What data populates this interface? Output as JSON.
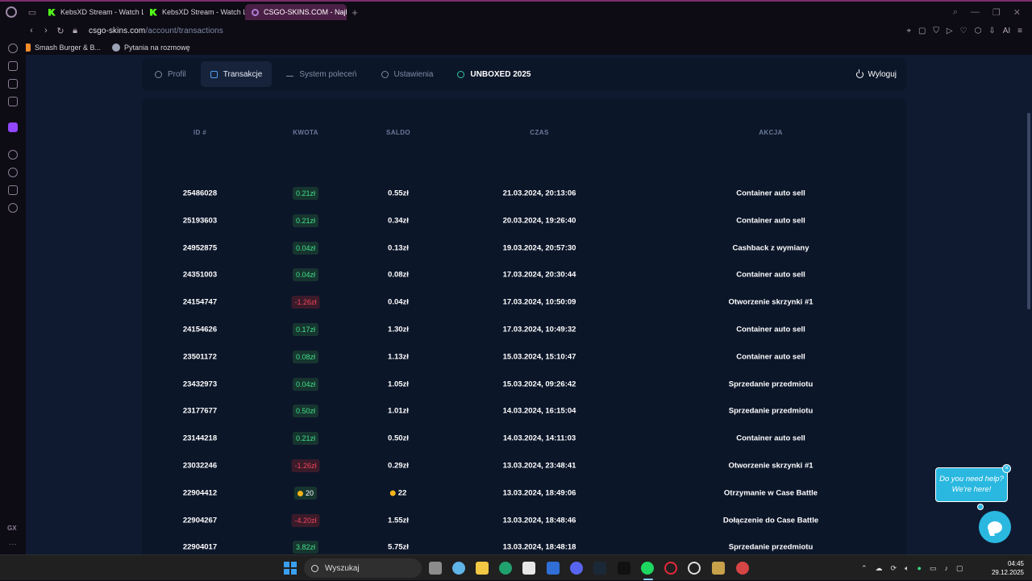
{
  "browser": {
    "tabs": [
      {
        "label": "KebsXD Stream - Watch Li",
        "icon": "kick-icon",
        "active": false
      },
      {
        "label": "KebsXD Stream - Watch Li",
        "icon": "kick-icon",
        "active": false
      },
      {
        "label": "CSGO-SKINS.COM - Najle",
        "icon": "opera-icon",
        "active": true
      }
    ],
    "url_host": "csgo-skins.com",
    "url_path": "/account/transactions",
    "bookmarks": [
      {
        "label": "Smash Burger & B...",
        "color": "#f28c28"
      },
      {
        "label": "Pytania na rozmowę",
        "color": "#9aa3b5"
      }
    ]
  },
  "account_nav": {
    "items": [
      {
        "label": "Profil",
        "icon": "user-icon"
      },
      {
        "label": "Transakcje",
        "icon": "card-icon"
      },
      {
        "label": "System poleceń",
        "icon": "crown-icon"
      },
      {
        "label": "Ustawienia",
        "icon": "gear-icon"
      },
      {
        "label": "UNBOXED 2025",
        "icon": "history-icon"
      }
    ],
    "logout": "Wyloguj"
  },
  "table": {
    "headers": {
      "id": "ID #",
      "amount": "KWOTA",
      "balance": "SALDO",
      "time": "CZAS",
      "action": "AKCJA"
    },
    "rows": [
      {
        "id": "25486028",
        "amount": "0.21zł",
        "type": "pos",
        "balance": "0.55zł",
        "time": "21.03.2024, 20:13:06",
        "action": "Container auto sell"
      },
      {
        "id": "25193603",
        "amount": "0.21zł",
        "type": "pos",
        "balance": "0.34zł",
        "time": "20.03.2024, 19:26:40",
        "action": "Container auto sell"
      },
      {
        "id": "24952875",
        "amount": "0.04zł",
        "type": "pos",
        "balance": "0.13zł",
        "time": "19.03.2024, 20:57:30",
        "action": "Cashback z wymiany"
      },
      {
        "id": "24351003",
        "amount": "0.04zł",
        "type": "pos",
        "balance": "0.08zł",
        "time": "17.03.2024, 20:30:44",
        "action": "Container auto sell"
      },
      {
        "id": "24154747",
        "amount": "-1.26zł",
        "type": "neg",
        "balance": "0.04zł",
        "time": "17.03.2024, 10:50:09",
        "action": "Otworzenie skrzynki #1"
      },
      {
        "id": "24154626",
        "amount": "0.17zł",
        "type": "pos",
        "balance": "1.30zł",
        "time": "17.03.2024, 10:49:32",
        "action": "Container auto sell"
      },
      {
        "id": "23501172",
        "amount": "0.08zł",
        "type": "pos",
        "balance": "1.13zł",
        "time": "15.03.2024, 15:10:47",
        "action": "Container auto sell"
      },
      {
        "id": "23432973",
        "amount": "0.04zł",
        "type": "pos",
        "balance": "1.05zł",
        "time": "15.03.2024, 09:26:42",
        "action": "Sprzedanie przedmiotu"
      },
      {
        "id": "23177677",
        "amount": "0.50zł",
        "type": "pos",
        "balance": "1.01zł",
        "time": "14.03.2024, 16:15:04",
        "action": "Sprzedanie przedmiotu"
      },
      {
        "id": "23144218",
        "amount": "0.21zł",
        "type": "pos",
        "balance": "0.50zł",
        "time": "14.03.2024, 14:11:03",
        "action": "Container auto sell"
      },
      {
        "id": "23032246",
        "amount": "-1.26zł",
        "type": "neg",
        "balance": "0.29zł",
        "time": "13.03.2024, 23:48:41",
        "action": "Otworzenie skrzynki #1"
      },
      {
        "id": "22904412",
        "amount": "20",
        "type": "coin",
        "balance": "22",
        "balance_coin": true,
        "time": "13.03.2024, 18:49:06",
        "action": "Otrzymanie w Case Battle"
      },
      {
        "id": "22904267",
        "amount": "-4.20zł",
        "type": "neg",
        "balance": "1.55zł",
        "time": "13.03.2024, 18:48:46",
        "action": "Dołączenie do Case Battle"
      },
      {
        "id": "22904017",
        "amount": "3.82zł",
        "type": "pos",
        "balance": "5.75zł",
        "time": "13.03.2024, 18:48:18",
        "action": "Sprzedanie przedmiotu"
      }
    ]
  },
  "help": {
    "line1": "Do you need help?",
    "line2": "We're here!"
  },
  "taskbar": {
    "search_label": "Wyszukaj",
    "time": "04:45",
    "date": "29.12.2025"
  },
  "colors": {
    "accent": "#2ab8e0",
    "positive": "#43e08a",
    "negative": "#f0455a",
    "opera_border": "#7b2c6b"
  }
}
